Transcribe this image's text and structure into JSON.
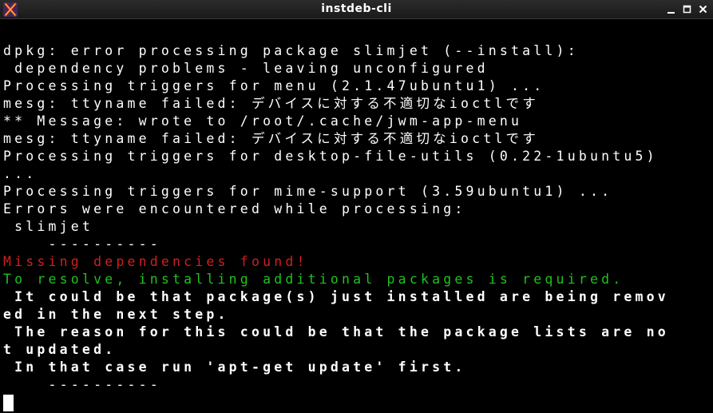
{
  "window": {
    "title": "instdeb-cli",
    "icon": "x-app-icon"
  },
  "controls": {
    "minimize": "minimize-icon",
    "maximize": "maximize-icon",
    "close": "close-icon"
  },
  "colors": {
    "background": "#000000",
    "foreground": "#ffffff",
    "error": "#d21e1e",
    "success": "#1ec31e"
  },
  "terminal": {
    "lines": [
      "dpkg: error processing package slimjet (--install):",
      " dependency problems - leaving unconfigured",
      "Processing triggers for menu (2.1.47ubuntu1) ...",
      "mesg: ttyname failed: デバイスに対する不適切なioctlです",
      "** Message: wrote to /root/.cache/jwm-app-menu",
      "mesg: ttyname failed: デバイスに対する不適切なioctlです",
      "Processing triggers for desktop-file-utils (0.22-1ubuntu5)",
      "...",
      "Processing triggers for mime-support (3.59ubuntu1) ...",
      "Errors were encountered while processing:",
      " slimjet",
      "    ----------",
      "Missing dependencies found!",
      "To resolve, installing additional packages is required.",
      " It could be that package(s) just installed are being remov",
      "ed in the next step.",
      " The reason for this could be that the package lists are no",
      "t updated.",
      " In that case run 'apt-get update' first.",
      "    ----------"
    ]
  }
}
